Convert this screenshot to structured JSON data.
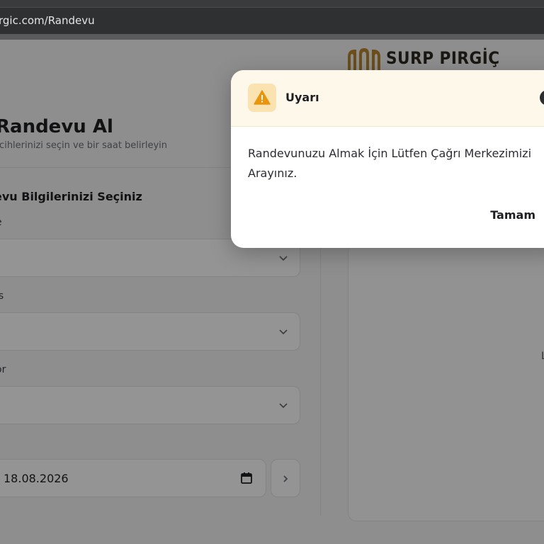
{
  "browser": {
    "url": "rgic.com/Randevu"
  },
  "brand": {
    "name": "SURP PIRGİÇ"
  },
  "page": {
    "title": "Randevu Al",
    "subtitle": "rcihlerinizi seçin ve bir saat belirleyin",
    "section_title": "evu Bilgilerinizi Seçiniz",
    "fields": [
      {
        "label": "e",
        "value": ""
      },
      {
        "label": "is",
        "value": ""
      },
      {
        "label": "or",
        "value": ""
      }
    ],
    "date": {
      "value": "18.08.2026"
    },
    "right_panel_text": "L"
  },
  "modal": {
    "title": "Uyarı",
    "message": "Randevunuzu Almak İçin Lütfen Çağrı Merkezimizi Arayınız.",
    "ok_label": "Tamam"
  },
  "colors": {
    "accent": "#f0a20e",
    "header_bg": "#fdf8ea",
    "overlay": "#000000"
  }
}
